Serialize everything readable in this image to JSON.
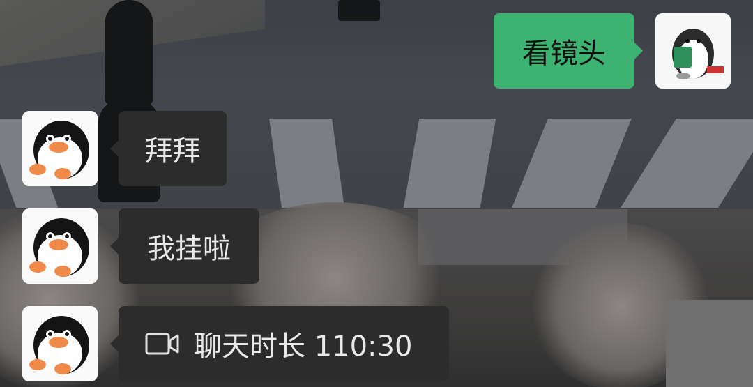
{
  "messages": [
    {
      "side": "right",
      "text": "看镜头",
      "avatar": "penguin-reading-icon"
    },
    {
      "side": "left",
      "text": "拜拜",
      "avatar": "penguin-avatar-icon"
    },
    {
      "side": "left",
      "text": "我挂啦",
      "avatar": "penguin-avatar-icon"
    },
    {
      "side": "left",
      "type": "video-call",
      "icon": "video-camera-icon",
      "text": "聊天时长 110:30",
      "avatar": "penguin-avatar-icon"
    }
  ],
  "colors": {
    "outgoing_bubble": "#3cb371",
    "incoming_bubble": "#2c2c2c",
    "incoming_text": "#e9e9e9"
  }
}
